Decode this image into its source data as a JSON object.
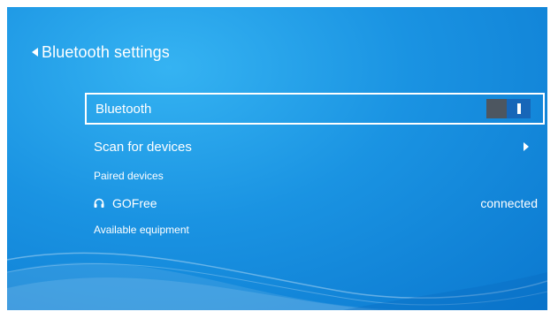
{
  "header": {
    "title": "Bluetooth settings",
    "back_icon": "triangle-left-icon"
  },
  "bluetooth": {
    "label": "Bluetooth",
    "enabled": true
  },
  "scan": {
    "label": "Scan for devices",
    "icon": "triangle-right-icon"
  },
  "paired": {
    "section_label": "Paired devices",
    "devices": [
      {
        "icon": "headphones-icon",
        "name": "GOFree",
        "status": "connected"
      }
    ]
  },
  "available": {
    "section_label": "Available equipment"
  },
  "colors": {
    "background": "#1a93e2",
    "toggle_track": "#4d5660",
    "toggle_knob": "#1766b8",
    "text": "#ffffff"
  }
}
